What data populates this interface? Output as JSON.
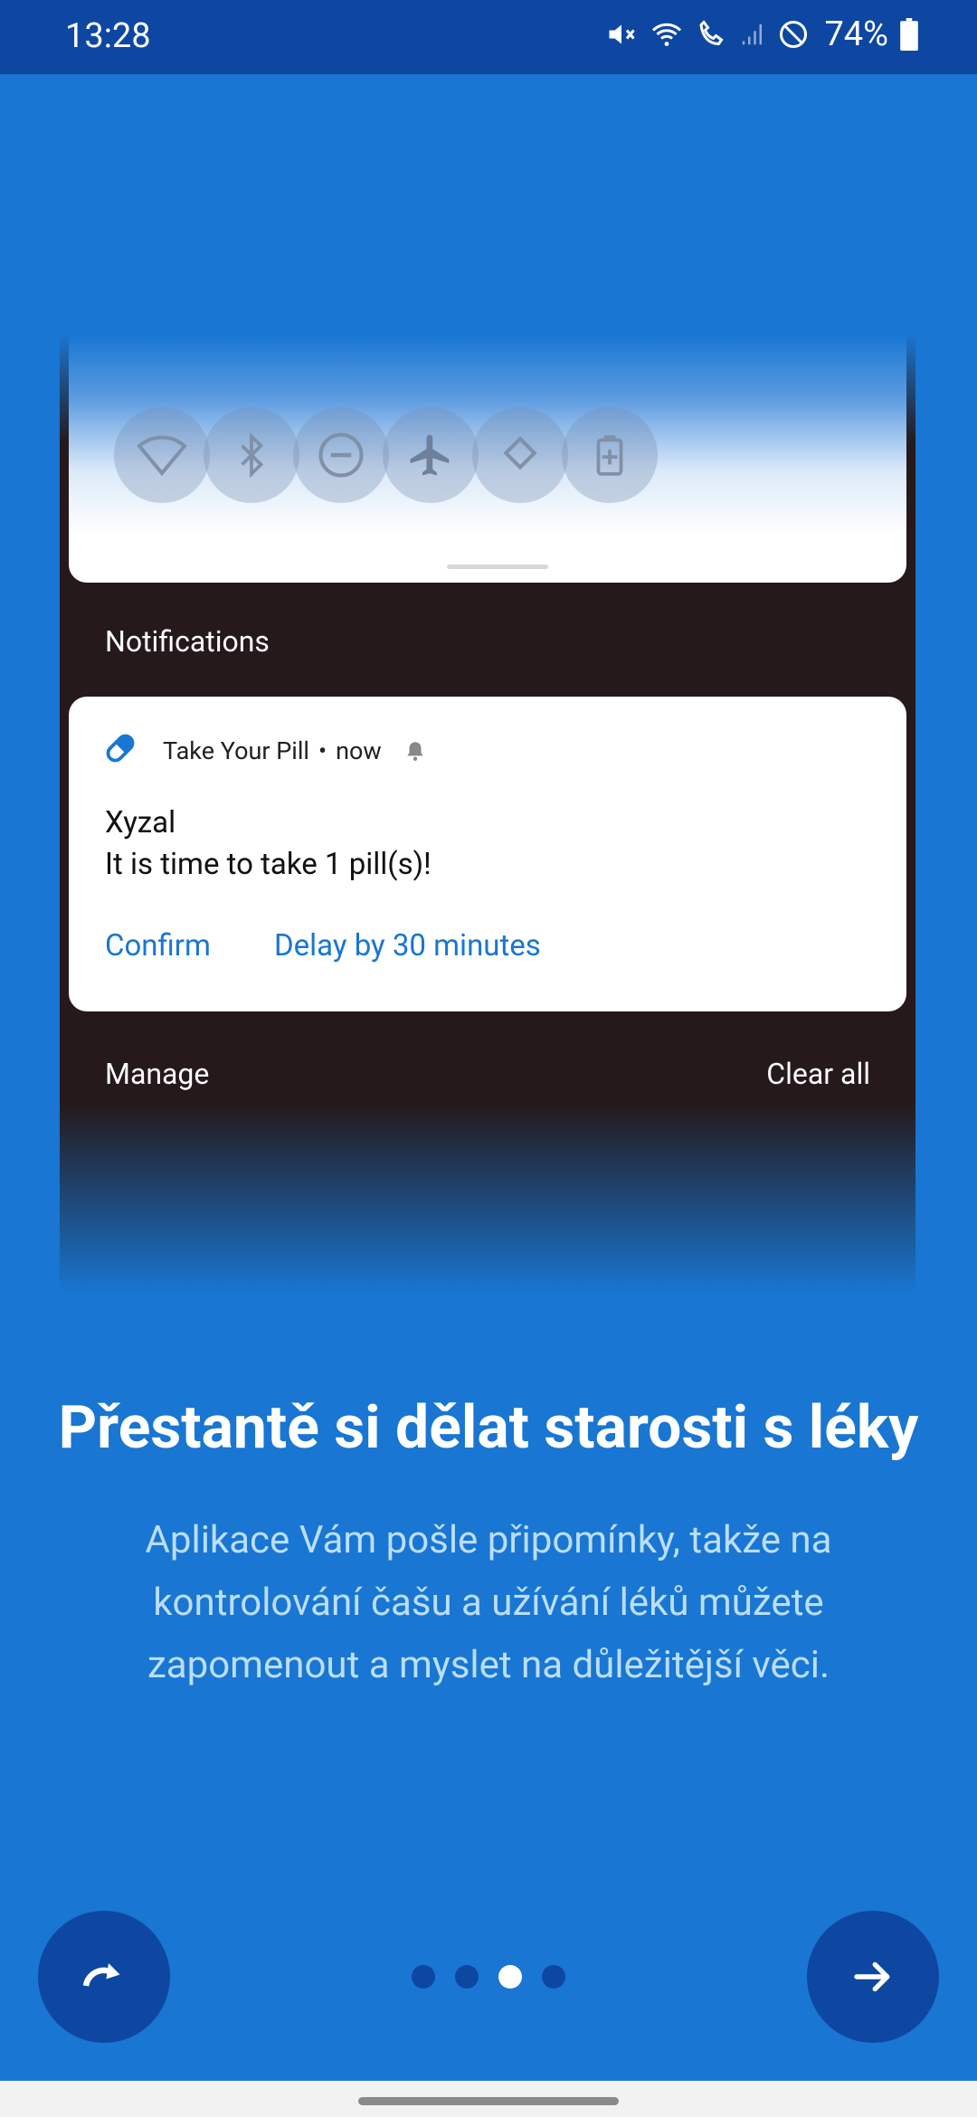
{
  "status_bar": {
    "time": "13:28",
    "battery": "74%"
  },
  "illustration": {
    "quick_settings": [
      "wifi-icon",
      "bluetooth-icon",
      "dnd-icon",
      "airplane-icon",
      "rotate-icon",
      "battery-saver-icon"
    ],
    "notifications_header": "Notifications",
    "notification": {
      "app_name": "Take Your Pill",
      "separator": "•",
      "time": "now",
      "title": "Xyzal",
      "body": "It is time to take 1 pill(s)!",
      "action_confirm": "Confirm",
      "action_delay": "Delay by 30 minutes"
    },
    "manage_label": "Manage",
    "clear_all_label": "Clear all"
  },
  "onboarding": {
    "title": "Přestantě si dělat starosti s léky",
    "description": "Aplikace Vám pošle připomínky, takže na kontrolování čašu a užívání léků můžete zapomenout a myslet na důležitější věci.",
    "page_current": 3,
    "page_total": 4
  },
  "colors": {
    "background": "#1976D2",
    "status_bar": "#0D47A1",
    "fab": "#0D47A1",
    "notification_action": "#1976D2",
    "description_text": "#BBDEFB"
  }
}
